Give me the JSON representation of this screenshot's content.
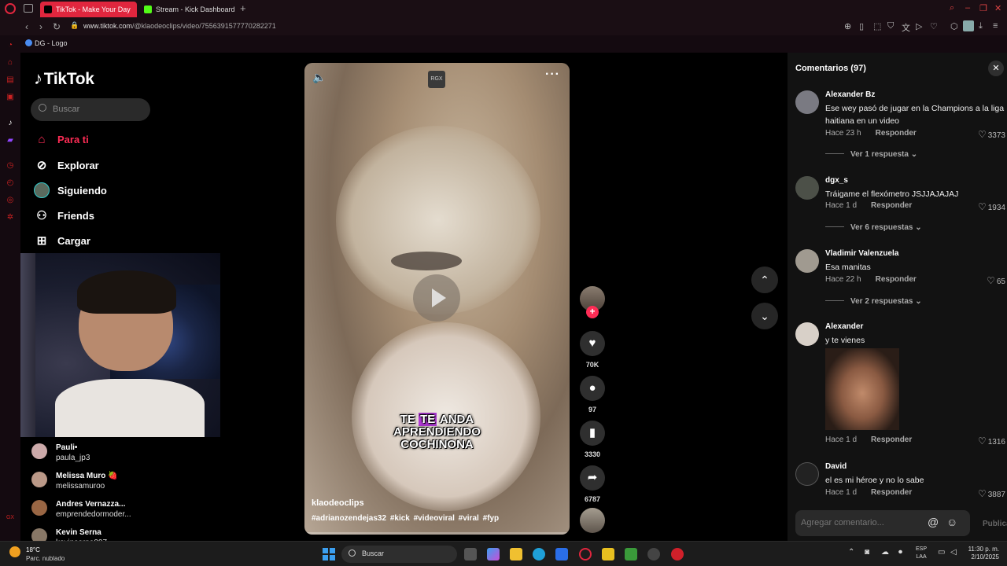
{
  "browser": {
    "tabs": [
      {
        "label": "TikTok - Make Your Day",
        "active": true
      },
      {
        "label": "Stream - Kick Dashboard",
        "active": false
      }
    ],
    "url_prefix": "www.tiktok.com",
    "url_rest": "/@klaodeoclips/video/7556391577770282271",
    "bookmark": "DG - Logo"
  },
  "sidebar": {
    "logo": "TikTok",
    "search_placeholder": "Buscar",
    "nav": [
      {
        "label": "Para ti",
        "icon": "home-icon"
      },
      {
        "label": "Explorar",
        "icon": "compass-icon"
      },
      {
        "label": "Siguiendo",
        "icon": "avatar-icon"
      },
      {
        "label": "Friends",
        "icon": "friends-icon"
      },
      {
        "label": "Cargar",
        "icon": "upload-icon"
      }
    ],
    "following": [
      {
        "name": "Pauli•",
        "user": "paula_jp3"
      },
      {
        "name": "Melissa Muro 🍓",
        "user": "melissamuroo"
      },
      {
        "name": "Andres Vernazza...",
        "user": "emprendedormoder..."
      },
      {
        "name": "Kevin Serna",
        "user": "kevinserna007"
      }
    ]
  },
  "video": {
    "watermark": "RGX",
    "caption_word1": "TE",
    "caption_highlight": "TE",
    "caption_rest1": "ANDA",
    "caption_line2": "APRENDIENDO",
    "caption_line3": "COCHINONA",
    "author": "klaodeoclips",
    "tags": "#adrianozendejas32 #kick #videoviral #viral #fyp"
  },
  "actions": {
    "likes": "70K",
    "comments": "97",
    "saves": "3330",
    "shares": "6787"
  },
  "comments": {
    "title": "Comentarios (97)",
    "input_placeholder": "Agregar comentario...",
    "publish": "Publicar",
    "reply_label": "Responder",
    "items": [
      {
        "name": "Alexander Bz",
        "text": "Ese wey pasó de jugar en la Champions a la liga haitiana en un video",
        "time": "Hace 23 h",
        "likes": "3373",
        "more": "Ver 1 respuesta"
      },
      {
        "name": "dgx_s",
        "text": "Tráigame el flexómetro JSJJAJAJAJ",
        "time": "Hace 1 d",
        "likes": "1934",
        "more": "Ver 6 respuestas"
      },
      {
        "name": "Vladimir Valenzuela",
        "text": "Esa manitas",
        "time": "Hace 22 h",
        "likes": "65",
        "more": "Ver 2 respuestas"
      },
      {
        "name": "Alexander",
        "text": "y te vienes",
        "time": "Hace 1 d",
        "likes": "1316"
      },
      {
        "name": "David",
        "text": "el es mi héroe y no lo sabe",
        "time": "Hace 1 d",
        "likes": "3887"
      }
    ]
  },
  "taskbar": {
    "temp": "18°C",
    "weather": "Parc. nublado",
    "search_placeholder": "Buscar",
    "lang1": "ESP",
    "lang2": "LAA",
    "time": "11:30 p. m.",
    "date": "2/10/2025"
  }
}
